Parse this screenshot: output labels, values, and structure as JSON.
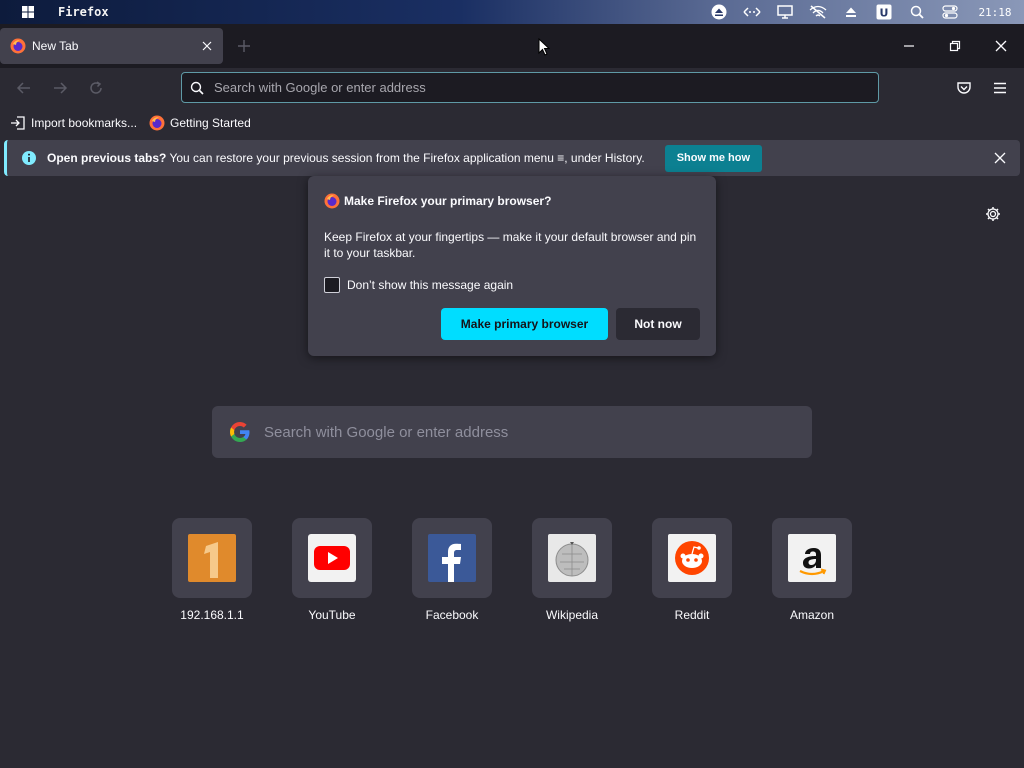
{
  "taskbar": {
    "app_title": "Firefox",
    "clock": "21:18",
    "tray_icons": [
      "eject-icon",
      "network-icon",
      "display-icon",
      "wifi-off-icon",
      "eject-icon-2",
      "u-app-icon",
      "search-icon",
      "toggle-icon"
    ]
  },
  "tabs": [
    {
      "title": "New Tab",
      "active": true
    }
  ],
  "navbar": {
    "url_placeholder": "Search with Google or enter address"
  },
  "bookmarks": [
    {
      "label": "Import bookmarks...",
      "icon": "import-icon"
    },
    {
      "label": "Getting Started",
      "icon": "firefox-icon"
    }
  ],
  "notification": {
    "bold_text": "Open previous tabs?",
    "text": " You can restore your previous session from the Firefox application menu ≡, under History.",
    "button_label": "Show me how"
  },
  "popup": {
    "title": "Make Firefox your primary browser?",
    "body": "Keep Firefox at your fingertips — make it your default browser and pin it to your taskbar.",
    "checkbox_label": "Don’t show this message again",
    "checkbox_checked": false,
    "primary_button": "Make primary browser",
    "secondary_button": "Not now"
  },
  "newtab": {
    "search_placeholder": "Search with Google or enter address",
    "top_sites": [
      {
        "label": "192.168.1.1",
        "icon": "number-one-icon"
      },
      {
        "label": "YouTube",
        "icon": "youtube-icon"
      },
      {
        "label": "Facebook",
        "icon": "facebook-icon"
      },
      {
        "label": "Wikipedia",
        "icon": "wikipedia-icon"
      },
      {
        "label": "Reddit",
        "icon": "reddit-icon"
      },
      {
        "label": "Amazon",
        "icon": "amazon-icon"
      }
    ]
  },
  "colors": {
    "accent": "#00ddff",
    "notification_button": "#0c8091",
    "background": "#2b2a33",
    "surface": "#42414d"
  }
}
